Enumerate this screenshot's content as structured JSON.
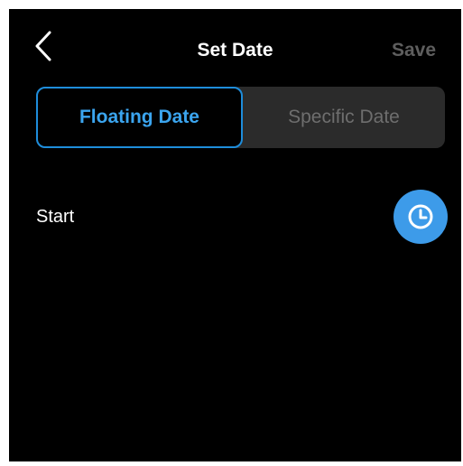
{
  "header": {
    "back_icon": "chevron-left-icon",
    "title": "Set Date",
    "save_label": "Save"
  },
  "date_mode": {
    "options": [
      "Floating Date",
      "Specific Date"
    ],
    "selected": "Floating Date"
  },
  "start": {
    "label": "Start",
    "icon": "clock-icon"
  },
  "colors": {
    "background": "#000000",
    "accent": "#3ba5ef",
    "clock_button": "#3d9be9",
    "inactive_text": "#6e6e6e",
    "disabled_save": "#5e5e5e",
    "segment_track": "#2b2b2b"
  }
}
